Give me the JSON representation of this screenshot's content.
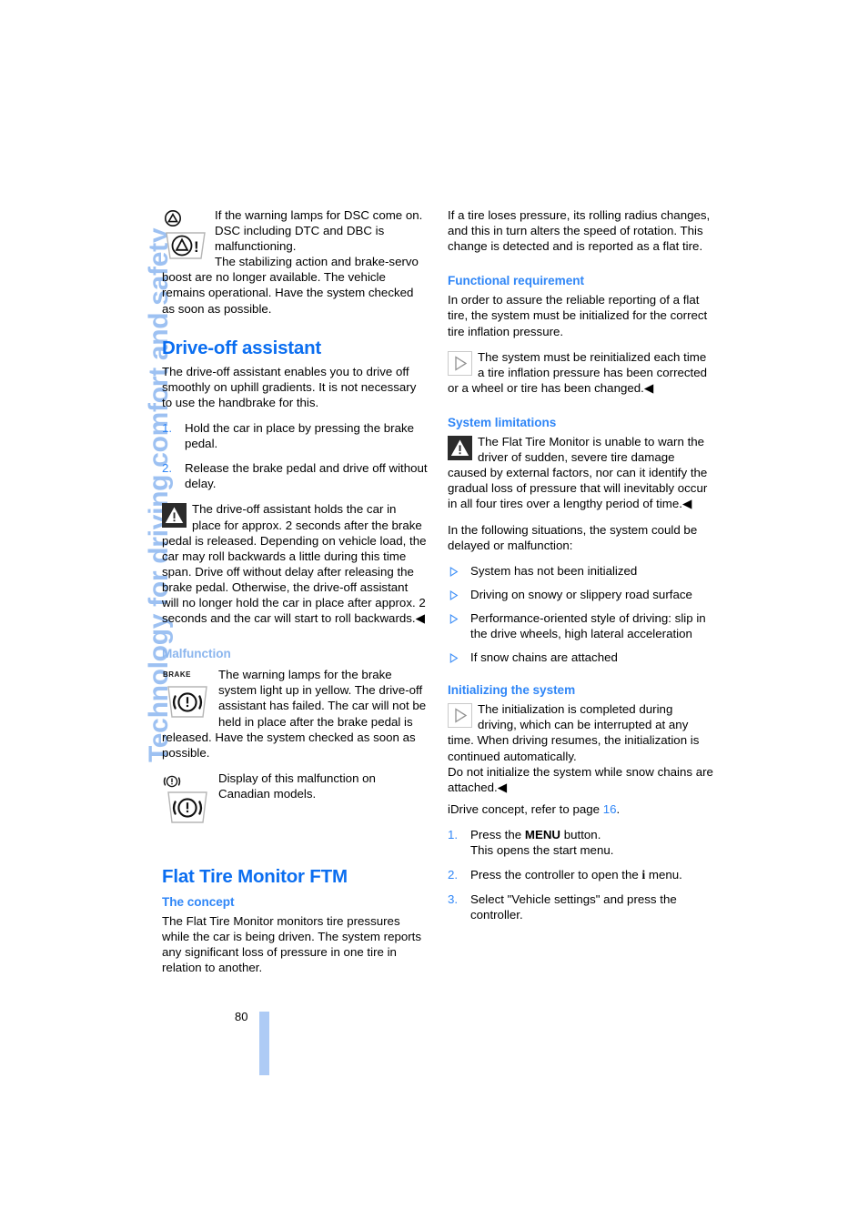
{
  "chapter_tab": {
    "label": "Technology for driving comfort and safety",
    "color": "#9dc1f2"
  },
  "folio": {
    "page_number": "80"
  },
  "colors": {
    "heading_blue": "#0b6ef0",
    "subheading_blue": "#2f86f7",
    "pale_blue": "#8cb6ee",
    "bar_blue": "#aecbf5"
  },
  "left_column": {
    "dsc_note": {
      "icon": "dsc-warning-lamp-icon",
      "text": "If the warning lamps for DSC come on. DSC including DTC and DBC is malfunctioning."
    },
    "dsc_note_cont": "The stabilizing action and brake-servo boost are no longer available. The vehicle remains operational. Have the system checked as soon as possible.",
    "drive_off_heading": "Drive-off assistant",
    "drive_off_intro": "The drive-off assistant enables you to drive off smoothly on uphill gradients. It is not necessary to use the handbrake for this.",
    "drive_off_steps": [
      {
        "num": "1.",
        "text": "Hold the car in place by pressing the brake pedal."
      },
      {
        "num": "2.",
        "text": "Release the brake pedal and drive off without delay."
      }
    ],
    "drive_off_warning": {
      "icon": "warning-triangle-icon",
      "text": "The drive-off assistant holds the car in place for approx. 2 seconds after the brake pedal is released. Depending on vehicle load, the car may roll backwards a little during this time span. Drive off without delay after releasing the brake pedal. Otherwise, the drive-off assistant will no longer hold the car in place after approx. 2 seconds and the car will start to roll backwards.",
      "end_mark": "◀"
    },
    "malfunction_heading": "Malfunction",
    "malfunction_note": {
      "icon": "brake-warning-lamp-icon",
      "icon_label": "BRAKE",
      "text": "The warning lamps for the brake system light up in yellow. The drive-off assistant has failed. The car will not be held in place after the brake pedal is released. Have the system checked as soon as possible."
    },
    "canadian_note": {
      "icon": "brake-warning-lamp-canadian-icon",
      "text": "Display of this malfunction on Canadian models."
    },
    "ftm_heading": "Flat Tire Monitor FTM",
    "concept_heading": "The concept",
    "concept_text": "The Flat Tire Monitor monitors tire pressures while the car is being driven. The system reports any significant loss of pressure in one tire in relation to another."
  },
  "right_column": {
    "intro_text": "If a tire loses pressure, its rolling radius changes, and this in turn alters the speed of rotation. This change is detected and is reported as a flat tire.",
    "functional_heading": "Functional requirement",
    "functional_text": "In order to assure the reliable reporting of a flat tire, the system must be initialized for the correct tire inflation pressure.",
    "functional_note": {
      "icon": "note-pointer-icon",
      "text": "The system must be reinitialized each time a tire inflation pressure has been corrected or a wheel or tire has been changed.",
      "end_mark": "◀"
    },
    "limitations_heading": "System limitations",
    "limitations_warning": {
      "icon": "warning-triangle-icon",
      "text": "The Flat Tire Monitor is unable to warn the driver of sudden, severe tire damage caused by external factors, nor can it identify the gradual loss of pressure that will inevitably occur in all four tires over a lengthy period of time.",
      "end_mark": "◀"
    },
    "situations_intro": "In the following situations, the system could be delayed or malfunction:",
    "situations": [
      "System has not been initialized",
      "Driving on snowy or slippery road surface",
      "Performance-oriented style of driving: slip in the drive wheels, high lateral acceleration",
      "If snow chains are attached"
    ],
    "initializing_heading": "Initializing the system",
    "initializing_note": {
      "icon": "note-pointer-icon",
      "text": "The initialization is completed during driving, which can be interrupted at any time. When driving resumes, the initialization is continued automatically.",
      "text2": "Do not initialize the system while snow chains are attached.",
      "end_mark": "◀"
    },
    "idrive_ref_prefix": "iDrive concept, refer to page ",
    "idrive_ref_page": "16",
    "idrive_ref_suffix": ".",
    "init_steps": [
      {
        "num": "1.",
        "pre": "Press the ",
        "kbd": "MENU",
        "post": " button.",
        "line2": "This opens the start menu."
      },
      {
        "num": "2.",
        "pre": "Press the controller to open the ",
        "glyph": "i",
        "post": " menu."
      },
      {
        "num": "3.",
        "pre": "Select \"Vehicle settings\" and press the controller."
      }
    ]
  }
}
